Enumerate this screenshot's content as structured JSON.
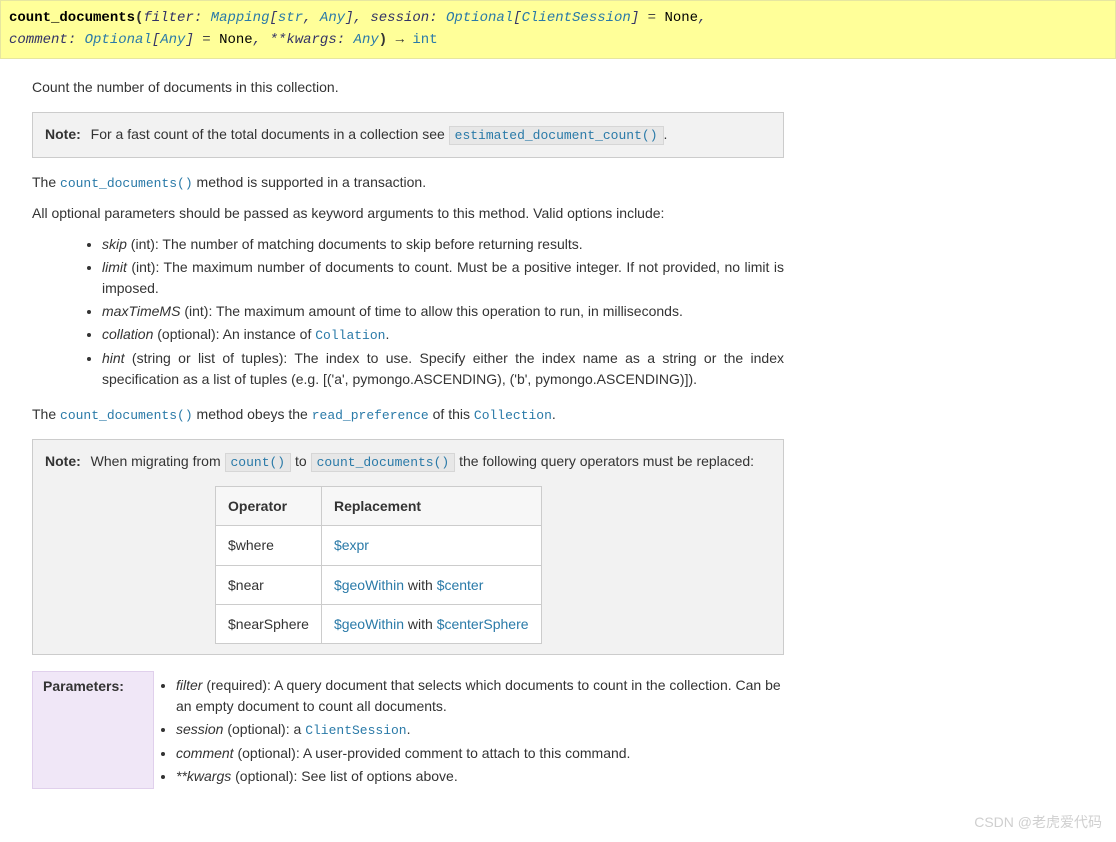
{
  "sig": {
    "name": "count_documents",
    "open": "(",
    "p1": "filter",
    "c1": ":",
    "t1": "Mapping",
    "br1l": "[",
    "t1a": "str",
    "comma1": ",",
    "t1b": "Any",
    "br1r": "]",
    "comma_after_p1": ",",
    "p2": "session",
    "c2": ":",
    "t2": "Optional",
    "br2l": "[",
    "t2a": "ClientSession",
    "br2r": "]",
    "eq2": "=",
    "d2": "None",
    "comma_after_p2": ",",
    "p3": "comment",
    "c3": ":",
    "t3": "Optional",
    "br3l": "[",
    "t3a": "Any",
    "br3r": "]",
    "eq3": "=",
    "d3": "None",
    "comma_after_p3": ",",
    "p4": "**kwargs",
    "c4": ":",
    "t4": "Any",
    "close": ")",
    "arrow": "→",
    "ret": "int"
  },
  "desc": "Count the number of documents in this collection.",
  "note1": {
    "title": "Note:",
    "text_before": "For a fast count of the total documents in a collection see ",
    "code": "estimated_document_count()",
    "text_after": "."
  },
  "p1": {
    "pre": "The ",
    "code": "count_documents()",
    "post": " method is supported in a transaction."
  },
  "p2": "All optional parameters should be passed as keyword arguments to this method. Valid options include:",
  "opts": [
    {
      "name": "skip",
      "rest": " (int): The number of matching documents to skip before returning results."
    },
    {
      "name": "limit",
      "rest": " (int): The maximum number of documents to count. Must be a positive integer. If not provided, no limit is imposed."
    },
    {
      "name": "maxTimeMS",
      "rest": " (int): The maximum amount of time to allow this operation to run, in milliseconds."
    },
    {
      "name": "collation",
      "rest_pre": " (optional): An instance of ",
      "link": "Collation",
      "rest_post": "."
    },
    {
      "name": "hint",
      "rest": " (string or list of tuples): The index to use. Specify either the index name as a string or the index specification as a list of tuples (e.g. [('a', pymongo.ASCENDING), ('b', pymongo.ASCENDING)])."
    }
  ],
  "p3": {
    "pre": "The ",
    "code1": "count_documents()",
    "mid1": " method obeys the ",
    "link1": "read_preference",
    "mid2": " of this ",
    "link2": "Collection",
    "post": "."
  },
  "note2": {
    "title": "Note:",
    "pre": "When migrating from ",
    "code1": "count()",
    "mid": " to ",
    "code2": "count_documents()",
    "post": " the following query operators must be replaced:",
    "hdr1": "Operator",
    "hdr2": "Replacement",
    "rows": [
      {
        "op": "$where",
        "repl_a": "$expr",
        "repl_mid": "",
        "repl_b": ""
      },
      {
        "op": "$near",
        "repl_a": "$geoWithin",
        "repl_mid": " with ",
        "repl_b": "$center"
      },
      {
        "op": "$nearSphere",
        "repl_a": "$geoWithin",
        "repl_mid": " with ",
        "repl_b": "$centerSphere"
      }
    ]
  },
  "params": {
    "title": "Parameters:",
    "items": [
      {
        "name": "filter",
        "rest": " (required): A query document that selects which documents to count in the collection. Can be an empty document to count all documents."
      },
      {
        "name": "session",
        "rest_pre": " (optional): a ",
        "link": "ClientSession",
        "rest_post": "."
      },
      {
        "name": "comment",
        "rest": " (optional): A user-provided comment to attach to this command."
      },
      {
        "name": "**kwargs",
        "rest": " (optional): See list of options above."
      }
    ]
  },
  "watermark": "CSDN @老虎爱代码"
}
